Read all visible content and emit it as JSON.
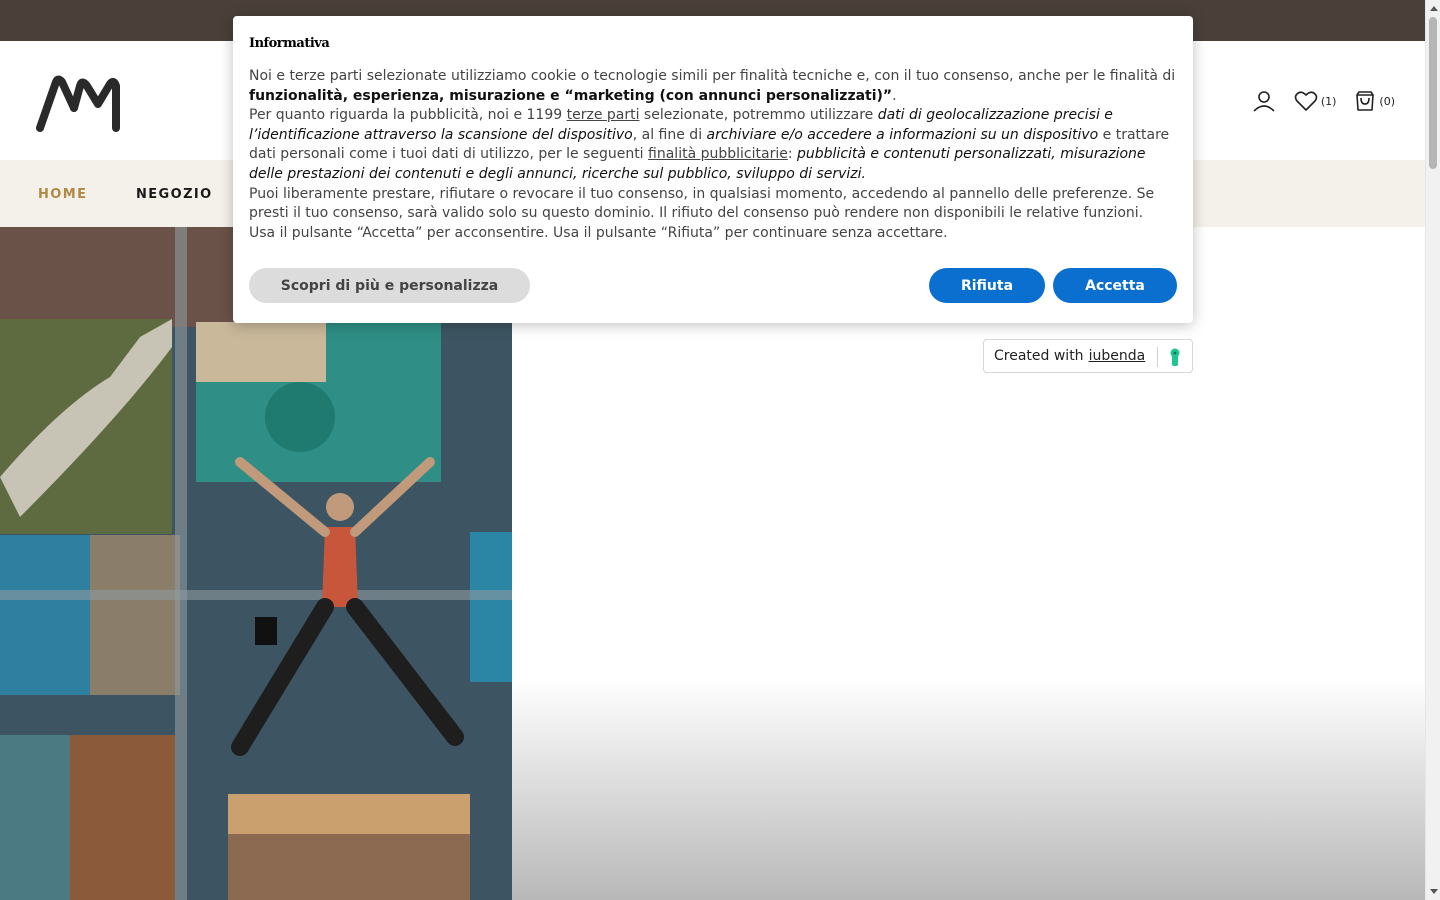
{
  "topbar": {
    "text": ""
  },
  "header": {
    "logo_text": "AM",
    "wishlist_count": "(1)",
    "cart_count": "(0)"
  },
  "nav": {
    "items": [
      {
        "label": "HOME",
        "active": true
      },
      {
        "label": "NEGOZIO",
        "active": false
      }
    ]
  },
  "cookie_modal": {
    "title": "Informativa",
    "p1_a": "Noi e terze parti selezionate utilizziamo cookie o tecnologie simili per finalità tecniche e, con il tuo consenso, anche per le finalità di ",
    "p1_b": "funzionalità, esperienza, misurazione e “marketing (con annunci personalizzati)”",
    "p1_c": ".",
    "p2_a": "Per quanto riguarda la pubblicità, noi e 1199 ",
    "p2_link1": "terze parti",
    "p2_b": " selezionate, potremmo utilizzare ",
    "p2_c": "dati di geolocalizzazione precisi e l’identificazione attraverso la scansione del dispositivo",
    "p2_d": ", al fine di ",
    "p2_e": "archiviare e/o accedere a informazioni su un dispositivo",
    "p2_f": " e trattare dati personali come i tuoi dati di utilizzo, per le seguenti ",
    "p2_link2": "finalità pubblicitarie",
    "p2_g": ": ",
    "p2_h": "pubblicità e contenuti personalizzati, misurazione delle prestazioni dei contenuti e degli annunci, ricerche sul pubblico, sviluppo di servizi.",
    "p3": "Puoi liberamente prestare, rifiutare o revocare il tuo consenso, in qualsiasi momento, accedendo al pannello delle preferenze. Se presti il tuo consenso, sarà valido solo su questo dominio. Il rifiuto del consenso può rendere non disponibili le relative funzioni.",
    "p4": "Usa il pulsante “Accetta” per acconsentire. Usa il pulsante “Rifiuta” per continuare senza accettare.",
    "btn_more": "Scopri di più e personalizza",
    "btn_reject": "Rifiuta",
    "btn_accept": "Accetta"
  },
  "iubenda_badge": {
    "prefix": "Created with",
    "link": "iubenda"
  },
  "colors": {
    "topbar": "#4a4039",
    "nav_bg": "#f4f1ea",
    "nav_active": "#b08945",
    "button_blue": "#0b6fd0",
    "button_grey": "#dcdcdc",
    "iubenda_green": "#1cc691"
  },
  "icons": [
    "user-icon",
    "heart-icon",
    "cart-icon",
    "iubenda-keyhole-icon"
  ]
}
